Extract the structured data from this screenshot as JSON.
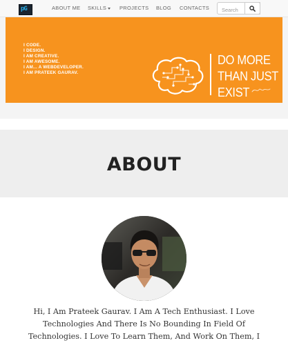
{
  "navbar": {
    "brand_text": "pG",
    "items": [
      {
        "label": "ABOUT ME"
      },
      {
        "label": "SKILLS"
      },
      {
        "label": "PROJECTS"
      },
      {
        "label": "BLOG"
      },
      {
        "label": "CONTACTS"
      }
    ],
    "search": {
      "placeholder": "Search",
      "value": "",
      "button_icon": "search-icon"
    }
  },
  "banner": {
    "background_color": "#f7931e",
    "taglines": [
      "I CODE.",
      "I DESIGN.",
      "I AM CREATIVE.",
      "I AM AWESOME.",
      "I AM... A WEBDEVELOPER.",
      "I AM PRATEEK GAURAV."
    ],
    "brain_icon": "circuit-brain-icon",
    "slogan_lines": [
      "DO MORE",
      "THAN JUST",
      "EXIST"
    ]
  },
  "about": {
    "title": "ABOUT",
    "bio": "Hi, I Am Prateek Gaurav. I Am A Tech Enthusiast. I Love Technologies And There Is No Bounding In Field Of Technologies. I Love To Learn Them, And Work On Them, I"
  }
}
